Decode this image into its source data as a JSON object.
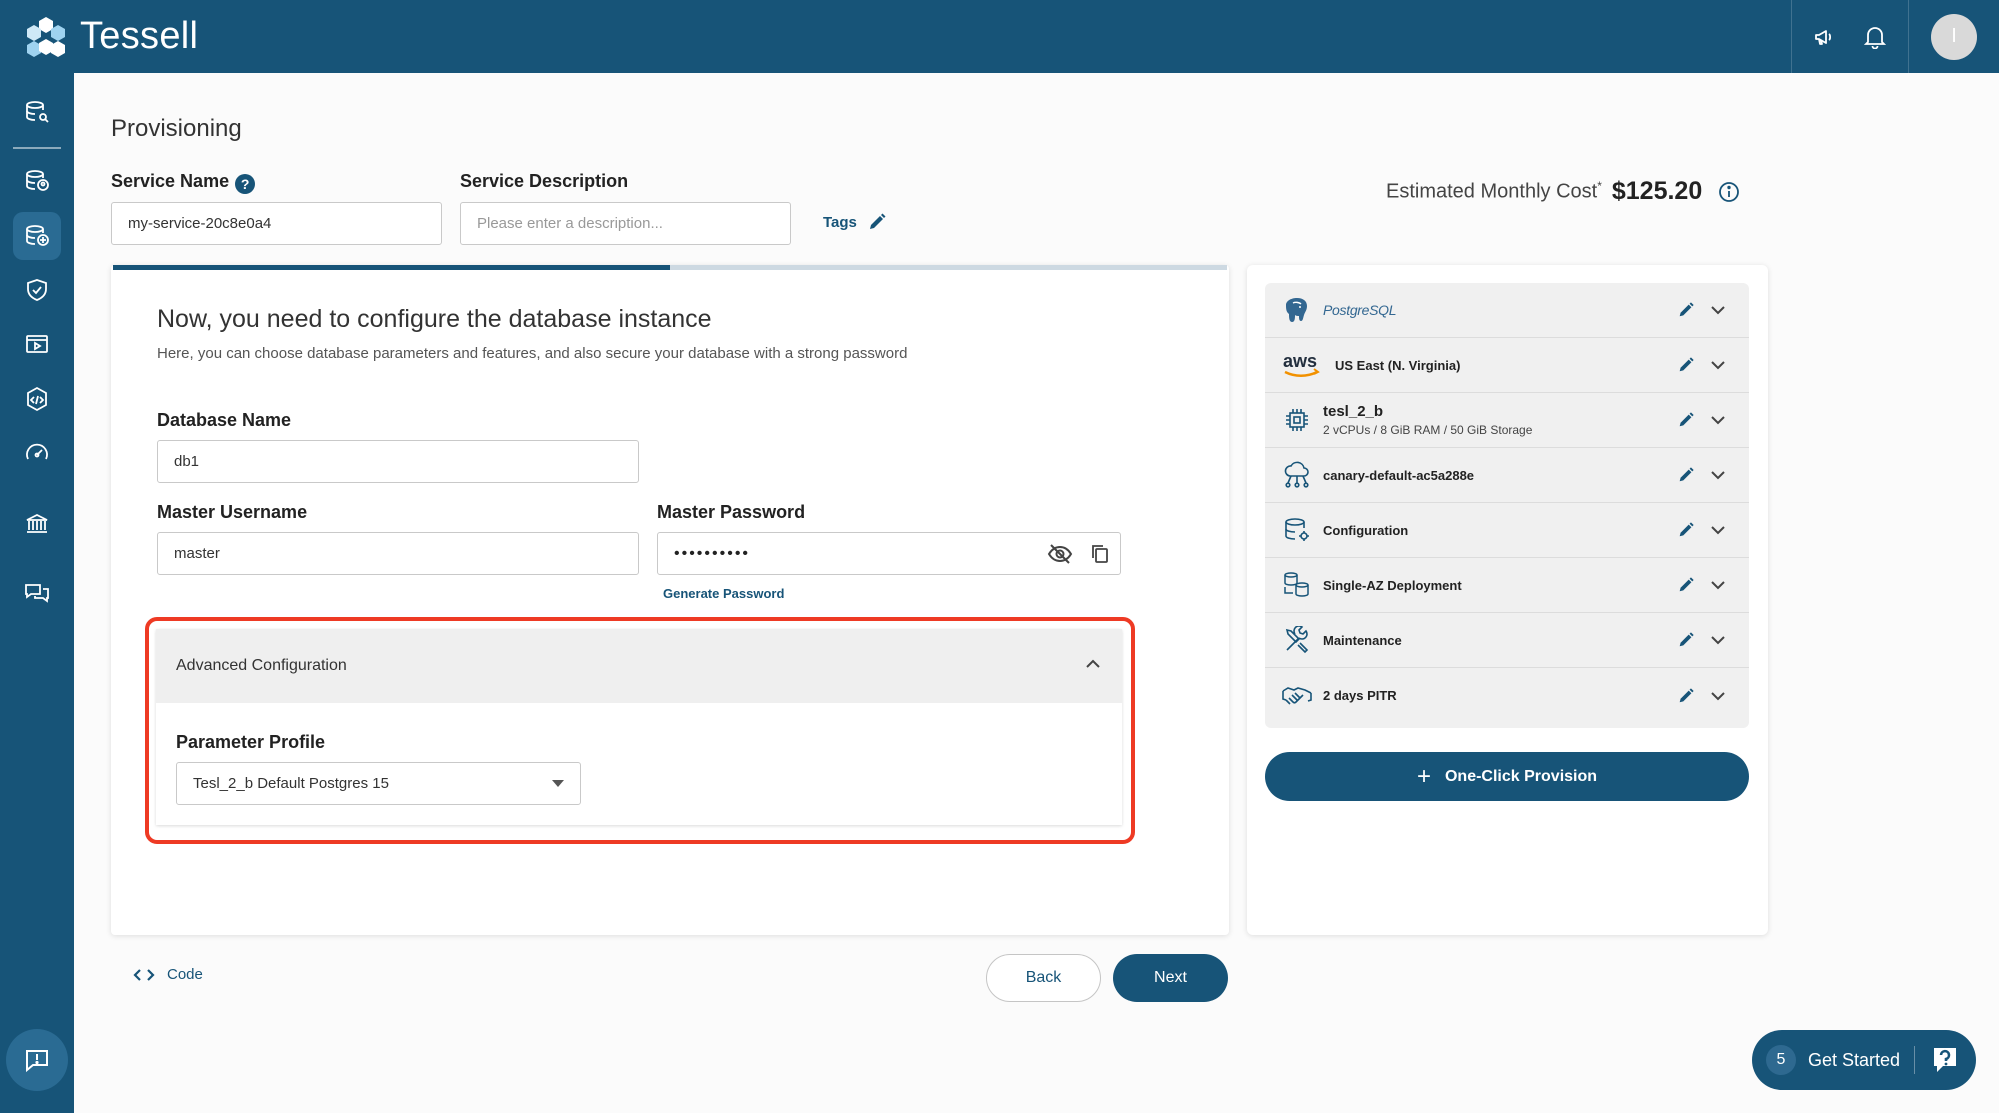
{
  "app": {
    "brand": "Tessell",
    "avatar_initial": "I"
  },
  "page": {
    "title": "Provisioning"
  },
  "service": {
    "name_label": "Service Name",
    "name_value": "my-service-20c8e0a4",
    "description_label": "Service Description",
    "description_placeholder": "Please enter a description...",
    "tags_label": "Tags"
  },
  "cost": {
    "label": "Estimated Monthly Cost",
    "asterisk": "*",
    "value": "$125.20"
  },
  "wizard": {
    "progress": 0.5,
    "heading": "Now, you need to configure the database instance",
    "subheading": "Here, you can choose database parameters and features, and also secure your database with a strong password",
    "db_name_label": "Database Name",
    "db_name_value": "db1",
    "username_label": "Master Username",
    "username_value": "master",
    "password_label": "Master Password",
    "password_mask": "••••••••••",
    "generate_password": "Generate Password",
    "advanced": {
      "title": "Advanced Configuration",
      "param_label": "Parameter Profile",
      "param_value": "Tesl_2_b Default Postgres 15"
    }
  },
  "summary": {
    "rows": [
      {
        "label": "PostgreSQL",
        "icon": "postgresql-icon"
      },
      {
        "label": "US East (N. Virginia)",
        "icon": "aws-icon",
        "icon_text": "aws"
      },
      {
        "label": "tesl_2_b",
        "sub": "2 vCPUs / 8 GiB RAM / 50 GiB Storage",
        "icon": "cpu-chip-icon"
      },
      {
        "label": "canary-default-ac5a288e",
        "icon": "cloud-network-icon"
      },
      {
        "label": "Configuration",
        "icon": "database-config-icon"
      },
      {
        "label": "Single-AZ Deployment",
        "icon": "deployment-icon"
      },
      {
        "label": "Maintenance",
        "icon": "tools-icon"
      },
      {
        "label": "2 days PITR",
        "icon": "handshake-icon"
      }
    ],
    "provision_label": "One-Click Provision"
  },
  "footer": {
    "code_label": "Code",
    "back_label": "Back",
    "next_label": "Next"
  },
  "get_started": {
    "count": "5",
    "label": "Get Started"
  },
  "colors": {
    "primary": "#175478",
    "highlight": "#ee3a24",
    "aws_orange": "#f29100",
    "postgres_blue": "#336791"
  }
}
